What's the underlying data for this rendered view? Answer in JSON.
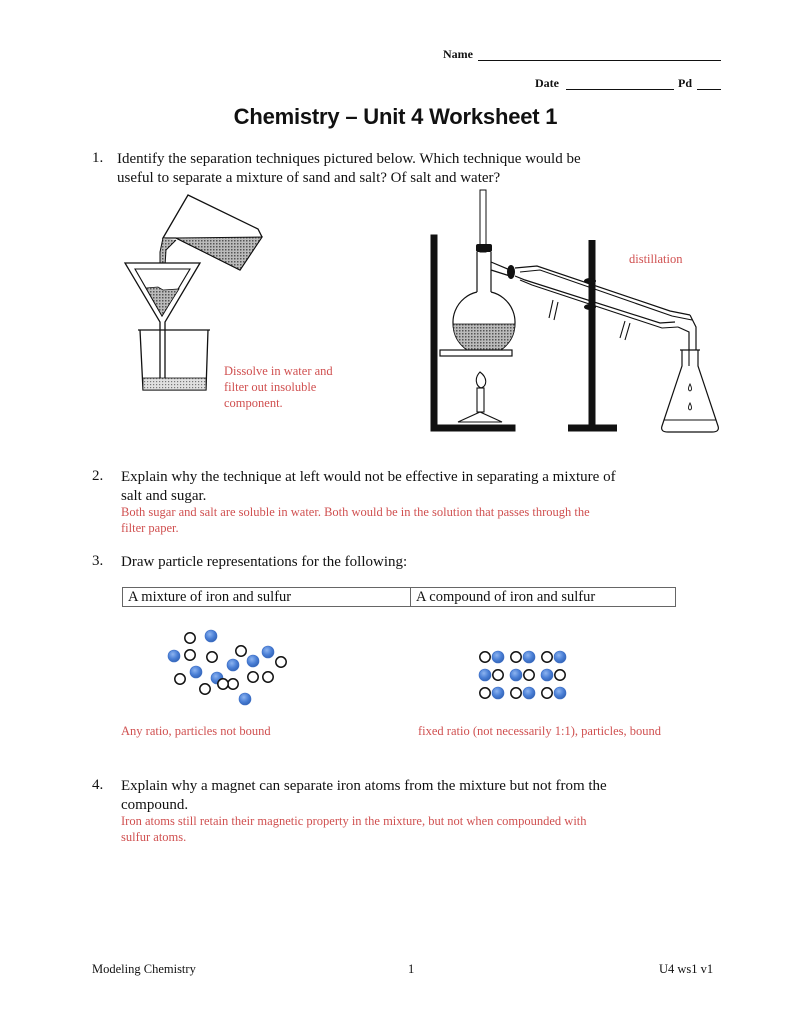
{
  "header": {
    "name_label": "Name",
    "date_label": "Date",
    "period_label": "Pd"
  },
  "title": "Chemistry – Unit 4 Worksheet 1",
  "questions": [
    {
      "number": "1.",
      "text_line1": "Identify the separation techniques pictured below.  Which technique would be",
      "text_line2": "useful to separate a mixture of sand and salt?  Of salt and water?",
      "figures": {
        "filtration": {
          "icon": "filtration-apparatus-icon",
          "answer_lines": [
            "Dissolve in water and",
            "filter out insoluble",
            "component."
          ]
        },
        "distillation": {
          "icon": "distillation-apparatus-icon",
          "answer": "distillation"
        }
      }
    },
    {
      "number": "2.",
      "text_line1": "Explain why the technique at left would not be effective in separating a mixture of",
      "text_line2": "salt and sugar.",
      "answer_lines": [
        "Both sugar and salt are soluble in water.  Both would be in the solution that passes through the",
        "filter paper."
      ]
    },
    {
      "number": "3.",
      "text_line1": "Draw particle representations for the following:",
      "table_headers": [
        "A mixture of iron and sulfur",
        "A compound of iron and sulfur"
      ],
      "mixture_caption": "Any ratio, particles not bound",
      "compound_caption": "fixed ratio (not necessarily 1:1), particles, bound",
      "legend": {
        "filled_particle": "blue-filled-particle",
        "open_particle": "open-circle-particle"
      },
      "mixture_particles": [
        {
          "type": "open",
          "col": 0,
          "row": 0
        }
      ]
    },
    {
      "number": "4.",
      "text_line1": "Explain why a magnet can separate iron atoms from the mixture but not from the",
      "text_line2": "compound.",
      "answer_lines": [
        "Iron atoms still retain their magnetic property in the mixture, but not when compounded with",
        "sulfur atoms."
      ]
    }
  ],
  "particle_counts": {
    "mixture_filled": 9,
    "mixture_open": 10,
    "compound_pairs": 9
  },
  "colors": {
    "answer_text": "#d05050",
    "particle_fill": "#4a7fd6",
    "particle_stroke": "#111111"
  },
  "footer": {
    "left": "Modeling Chemistry",
    "center": "1",
    "right": "U4 ws1 v1"
  }
}
